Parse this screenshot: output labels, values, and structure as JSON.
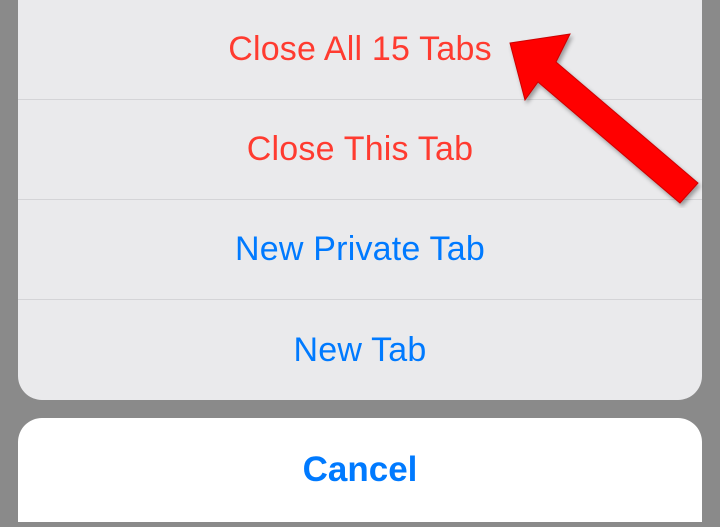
{
  "actionSheet": {
    "options": [
      {
        "label": "Close All 15 Tabs",
        "style": "destructive"
      },
      {
        "label": "Close This Tab",
        "style": "destructive"
      },
      {
        "label": "New Private Tab",
        "style": "normal"
      },
      {
        "label": "New Tab",
        "style": "normal"
      }
    ],
    "cancel_label": "Cancel"
  }
}
